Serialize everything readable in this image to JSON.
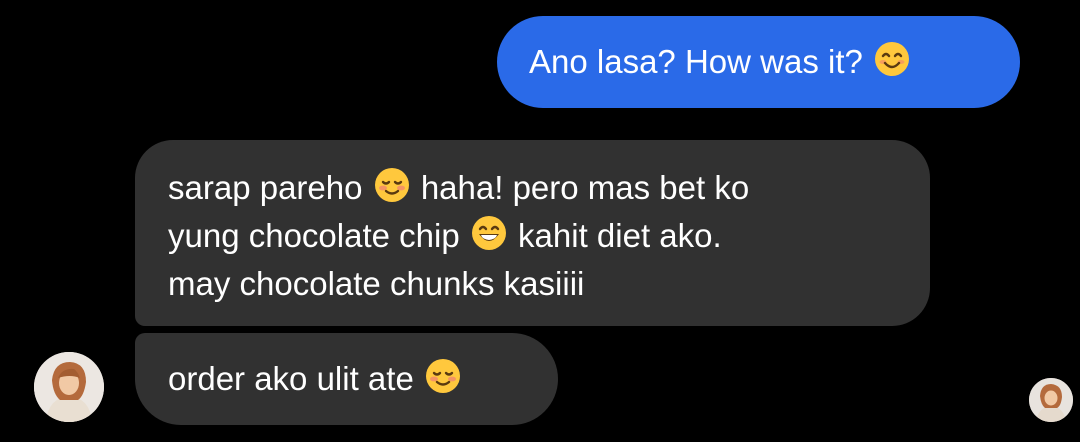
{
  "conversation": {
    "messages": [
      {
        "direction": "outgoing",
        "text": "Ano lasa? How was it?",
        "emoji": "smiling-eyes-emoji",
        "bubble_color": "#2a6ae8"
      },
      {
        "direction": "incoming",
        "bubble_color": "#313131",
        "lines": [
          {
            "before": "sarap pareho",
            "emoji": "smiling-blush-emoji",
            "after": "haha! pero mas bet ko"
          },
          {
            "before": "yung chocolate chip",
            "emoji": "grinning-emoji",
            "after": "kahit diet ako."
          },
          {
            "before": "may chocolate chunks kasiiii",
            "emoji": null,
            "after": ""
          }
        ]
      },
      {
        "direction": "incoming",
        "bubble_color": "#313131",
        "text": "order ako ulit ate",
        "emoji": "smiling-blush-emoji"
      }
    ],
    "contact_avatar": "contact-avatar-photo",
    "seen_avatar": "seen-receipt-avatar"
  },
  "colors": {
    "background": "#000000",
    "outgoing_bubble": "#2a6ae8",
    "incoming_bubble": "#313131",
    "text": "#ffffff",
    "emoji_face": "#ffc83d"
  }
}
